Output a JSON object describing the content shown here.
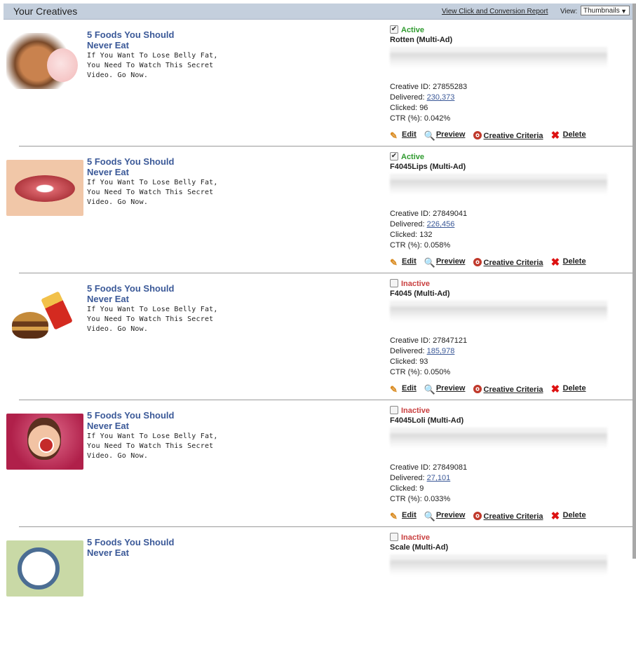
{
  "header": {
    "title": "Your Creatives",
    "report_link": "View Click and Conversion Report",
    "view_label": "View:",
    "view_selected": "Thumbnails"
  },
  "icons": {
    "check": "✔",
    "dropdown": "▼",
    "edit": "✎",
    "preview": "🔍",
    "delete": "✖"
  },
  "actions": {
    "edit": "Edit",
    "preview": "Preview",
    "criteria": "Creative Criteria",
    "delete": "Delete"
  },
  "creatives": [
    {
      "title": "5 Foods You Should Never Eat",
      "body": "If You Want To Lose Belly Fat, You Need To Watch This Secret Video. Go Now.",
      "thumbnail": "rotten-apple-image",
      "status": "Active",
      "checked": true,
      "name": "Rotten (Multi-Ad)",
      "creative_id_label": "Creative ID:",
      "creative_id": "27855283",
      "delivered_label": "Delivered:",
      "delivered": "230,373",
      "clicked_label": "Clicked:",
      "clicked": "96",
      "ctr_label": "CTR (%):",
      "ctr": "0.042%"
    },
    {
      "title": "5 Foods You Should Never Eat",
      "body": "If You Want To Lose Belly Fat, You Need To Watch This Secret Video. Go Now.",
      "thumbnail": "lips-image",
      "status": "Active",
      "checked": true,
      "name": "F4045Lips (Multi-Ad)",
      "creative_id_label": "Creative ID:",
      "creative_id": "27849041",
      "delivered_label": "Delivered:",
      "delivered": "226,456",
      "clicked_label": "Clicked:",
      "clicked": "132",
      "ctr_label": "CTR (%):",
      "ctr": "0.058%"
    },
    {
      "title": "5 Foods You Should Never Eat",
      "body": "If You Want To Lose Belly Fat, You Need To Watch This Secret Video. Go Now.",
      "thumbnail": "burger-fries-image",
      "status": "Inactive",
      "checked": false,
      "name": "F4045 (Multi-Ad)",
      "creative_id_label": "Creative ID:",
      "creative_id": "27847121",
      "delivered_label": "Delivered:",
      "delivered": "185,978",
      "clicked_label": "Clicked:",
      "clicked": "93",
      "ctr_label": "CTR (%):",
      "ctr": "0.050%"
    },
    {
      "title": "5 Foods You Should Never Eat",
      "body": "If You Want To Lose Belly Fat, You Need To Watch This Secret Video. Go Now.",
      "thumbnail": "woman-lollipop-image",
      "status": "Inactive",
      "checked": false,
      "name": "F4045Loli (Multi-Ad)",
      "creative_id_label": "Creative ID:",
      "creative_id": "27849081",
      "delivered_label": "Delivered:",
      "delivered": "27,101",
      "clicked_label": "Clicked:",
      "clicked": "9",
      "ctr_label": "CTR (%):",
      "ctr": "0.033%"
    },
    {
      "title": "5 Foods You Should Never Eat",
      "body": "",
      "thumbnail": "scale-image",
      "status": "Inactive",
      "checked": false,
      "name": "Scale (Multi-Ad)",
      "creative_id_label": "",
      "creative_id": "",
      "delivered_label": "",
      "delivered": "",
      "clicked_label": "",
      "clicked": "",
      "ctr_label": "",
      "ctr": ""
    }
  ],
  "colors": {
    "header_bg": "#c4cfdd",
    "title_blue": "#3b5998",
    "active_green": "#2e9a2e",
    "inactive_red": "#c94040"
  }
}
